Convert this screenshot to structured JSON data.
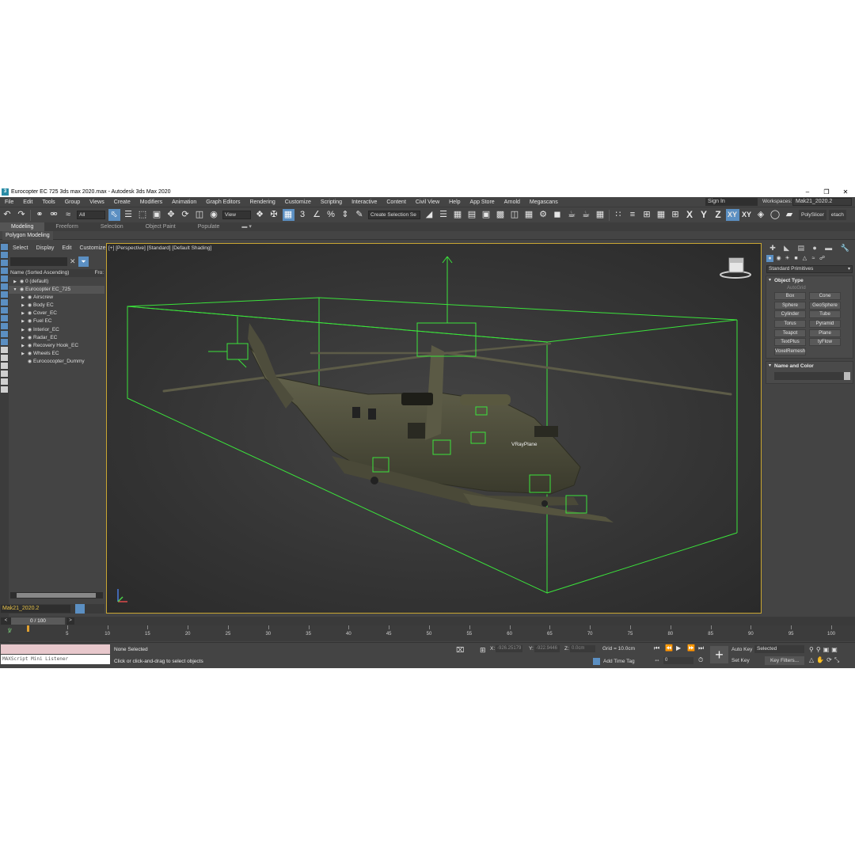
{
  "window": {
    "title": "Eurocopter EC 725 3ds max 2020.max - Autodesk 3ds Max 2020",
    "app_icon": "3"
  },
  "menubar": {
    "items": [
      "File",
      "Edit",
      "Tools",
      "Group",
      "Views",
      "Create",
      "Modifiers",
      "Animation",
      "Graph Editors",
      "Rendering",
      "Customize",
      "Scripting",
      "Interactive",
      "Content",
      "Civil View",
      "Help",
      "App Store",
      "Arnold",
      "Megascans"
    ],
    "sign_in": "Sign In",
    "workspaces_label": "Workspaces:",
    "workspace_value": "Mak21_2020.2"
  },
  "toolbar": {
    "filter_value": "All",
    "refcoord_value": "View",
    "selection_set": "Create Selection Se",
    "axes": [
      "X",
      "Y",
      "Z",
      "XY",
      "XY"
    ],
    "polyslicer": "PolySlicer",
    "detach": "etach"
  },
  "ribbon": {
    "tabs": [
      "Modeling",
      "Freeform",
      "Selection",
      "Object Paint",
      "Populate"
    ],
    "panel_label": "Polygon Modeling"
  },
  "explorer": {
    "menu": [
      "Select",
      "Display",
      "Edit",
      "Customize"
    ],
    "header": "Name (Sorted Ascending)",
    "header_right": "Fro:",
    "rows": [
      {
        "name": "0 (default)",
        "indent": 0,
        "expand": "▶",
        "selected": false
      },
      {
        "name": "Eurocopter EC_725",
        "indent": 0,
        "expand": "▼",
        "selected": true
      },
      {
        "name": "Airscrew",
        "indent": 1,
        "expand": "▶",
        "selected": false
      },
      {
        "name": "Body EC",
        "indent": 1,
        "expand": "▶",
        "selected": false
      },
      {
        "name": "Cover_EC",
        "indent": 1,
        "expand": "▶",
        "selected": false
      },
      {
        "name": "Fuel EC",
        "indent": 1,
        "expand": "▶",
        "selected": false
      },
      {
        "name": "Interior_EC",
        "indent": 1,
        "expand": "▶",
        "selected": false
      },
      {
        "name": "Radar_EC",
        "indent": 1,
        "expand": "▶",
        "selected": false
      },
      {
        "name": "Recovery Hook_EC",
        "indent": 1,
        "expand": "▶",
        "selected": false
      },
      {
        "name": "Wheels EC",
        "indent": 1,
        "expand": "▶",
        "selected": false
      },
      {
        "name": "Eurococopter_Dummy",
        "indent": 1,
        "expand": "",
        "selected": false
      }
    ],
    "layer": "Mak21_2020.2"
  },
  "viewport": {
    "label": "[+] [Perspective] [Standard] [Default Shading]",
    "object_label": "VRayPlane"
  },
  "command_panel": {
    "category": "Standard Primitives",
    "object_type_title": "Object Type",
    "autogrid": "AutoGrid",
    "primitives": [
      "Box",
      "Cone",
      "Sphere",
      "GeoSphere",
      "Cylinder",
      "Tube",
      "Torus",
      "Pyramid",
      "Teapot",
      "Plane",
      "TextPlus",
      "tyFlow",
      "VoxelRemesh"
    ],
    "name_color_title": "Name and Color"
  },
  "timeline": {
    "frame_display": "0 / 100",
    "prev": "<",
    "next": ">",
    "ticks": [
      0,
      5,
      10,
      15,
      20,
      25,
      30,
      35,
      40,
      45,
      50,
      55,
      60,
      65,
      70,
      75,
      80,
      85,
      90,
      95,
      100
    ],
    "tick_labels": [
      "5",
      "10",
      "15",
      "20",
      "25",
      "30",
      "35",
      "40",
      "45",
      "50",
      "55",
      "60",
      "65",
      "70",
      "75",
      "80",
      "85",
      "90",
      "95",
      "100"
    ]
  },
  "status": {
    "listener": "MAXScript Mini Listener",
    "selection": "None Selected",
    "prompt": "Click or click-and-drag to select objects",
    "x_label": "X:",
    "x_value": "-926.25179",
    "y_label": "Y:",
    "y_value": "-922.9446",
    "z_label": "Z:",
    "z_value": "0.0cm",
    "grid": "Grid = 10.0cm",
    "add_time_tag": "Add Time Tag",
    "frame": "0",
    "auto_key": "Auto Key",
    "set_key": "Set Key",
    "selected": "Selected",
    "key_filters": "Key Filters..."
  }
}
